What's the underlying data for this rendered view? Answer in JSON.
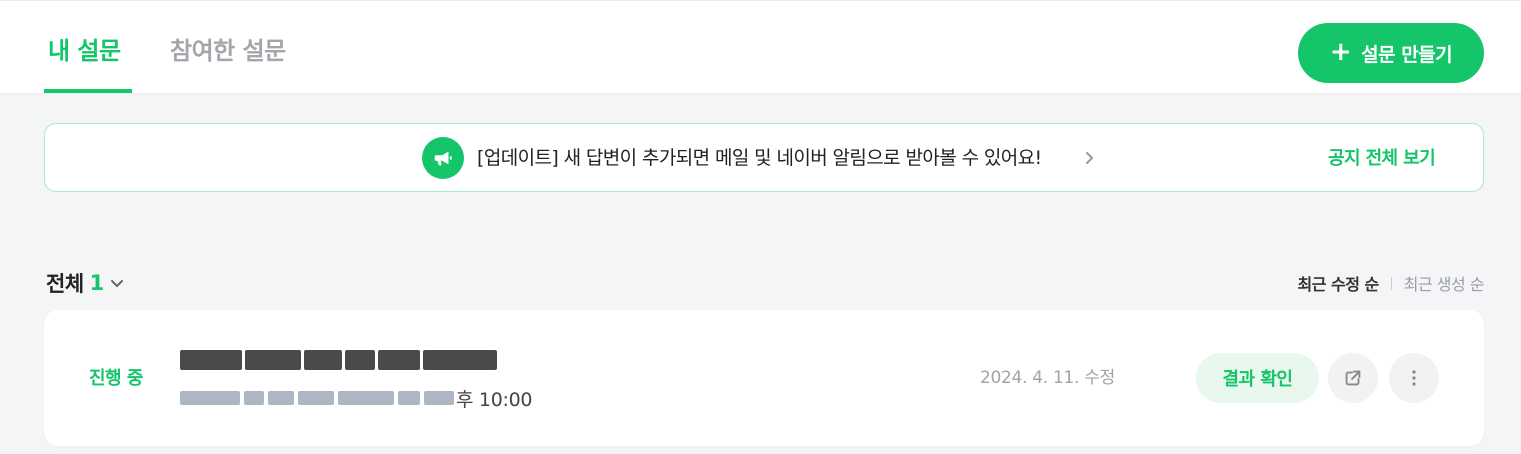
{
  "tabs": [
    {
      "label": "내 설문",
      "active": true
    },
    {
      "label": "참여한 설문",
      "active": false
    }
  ],
  "create_button": {
    "label": "설문 만들기",
    "icon": "plus-icon"
  },
  "notice": {
    "icon": "megaphone-icon",
    "text": "[업데이트] 새 답변이 추가되면 메일 및 네이버 알림으로 받아볼 수 있어요!",
    "link_label": "공지 전체 보기"
  },
  "list": {
    "filter_label": "전체",
    "count": "1",
    "sort": {
      "active": "최근 수정 순",
      "inactive": "최근 생성 순"
    }
  },
  "survey": {
    "status": "진행 중",
    "title_redacted": true,
    "period_end": "후 10:00",
    "modified": "2024. 4. 11. 수정",
    "result_label": "결과 확인"
  },
  "colors": {
    "accent": "#14c56a",
    "accent_light": "#e8f8ef",
    "notice_border": "#a5ecc4",
    "background": "#f4f5f7"
  }
}
